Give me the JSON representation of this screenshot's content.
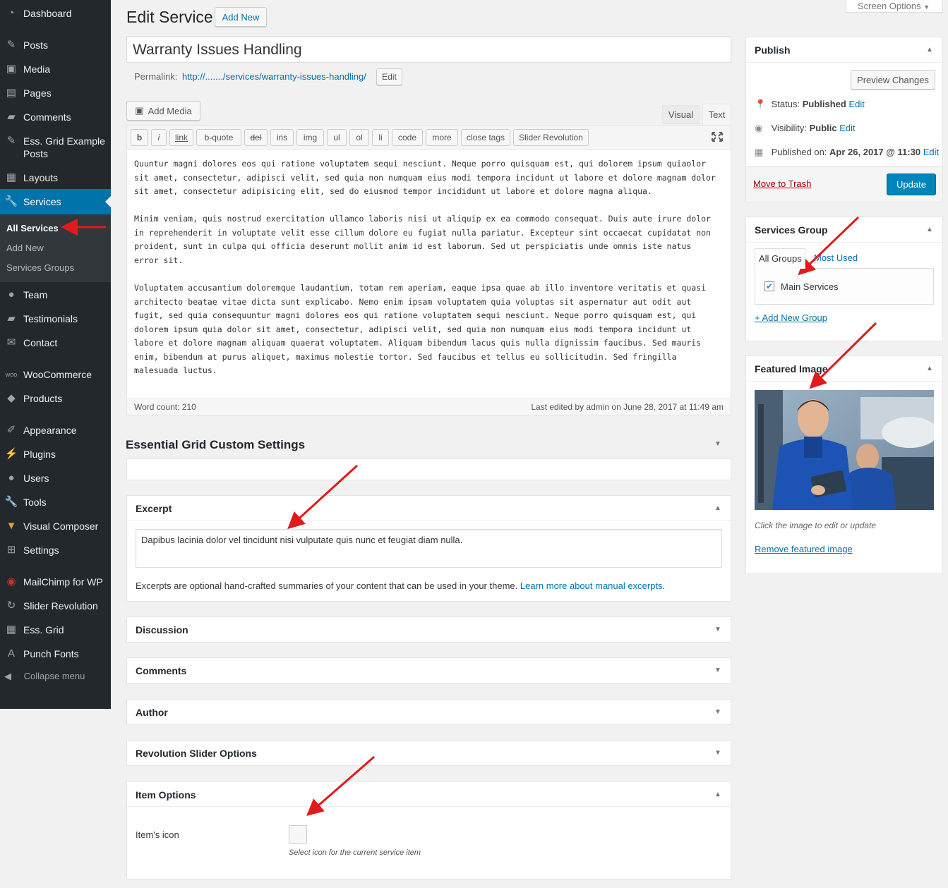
{
  "sidebar": {
    "items": [
      {
        "label": "Dashboard",
        "icon": "dashboard-icon"
      },
      {
        "label": "Posts",
        "icon": "pin-icon"
      },
      {
        "label": "Media",
        "icon": "media-icon"
      },
      {
        "label": "Pages",
        "icon": "pages-icon"
      },
      {
        "label": "Comments",
        "icon": "comment-icon"
      },
      {
        "label": "Ess. Grid Example Posts",
        "icon": "pin-icon"
      },
      {
        "label": "Layouts",
        "icon": "layouts-icon"
      },
      {
        "label": "Services",
        "icon": "wrench-icon"
      },
      {
        "label": "Team",
        "icon": "users-icon"
      },
      {
        "label": "Testimonials",
        "icon": "comment-icon"
      },
      {
        "label": "Contact",
        "icon": "mail-icon"
      },
      {
        "label": "WooCommerce",
        "icon": "woo-icon"
      },
      {
        "label": "Products",
        "icon": "box-icon"
      },
      {
        "label": "Appearance",
        "icon": "brush-icon"
      },
      {
        "label": "Plugins",
        "icon": "plugin-icon"
      },
      {
        "label": "Users",
        "icon": "user-icon"
      },
      {
        "label": "Tools",
        "icon": "tools-icon"
      },
      {
        "label": "Visual Composer",
        "icon": "vc-icon"
      },
      {
        "label": "Settings",
        "icon": "settings-icon"
      },
      {
        "label": "MailChimp for WP",
        "icon": "mailchimp-icon"
      },
      {
        "label": "Slider Revolution",
        "icon": "refresh-icon"
      },
      {
        "label": "Ess. Grid",
        "icon": "grid-icon"
      },
      {
        "label": "Punch Fonts",
        "icon": "font-icon"
      }
    ],
    "submenu": [
      "All Services",
      "Add New",
      "Services Groups"
    ],
    "collapse": "Collapse menu"
  },
  "header": {
    "title": "Edit Service",
    "add_new": "Add New",
    "screen_options": "Screen Options"
  },
  "editor": {
    "post_title": "Warranty Issues Handling",
    "permalink_label": "Permalink:",
    "permalink_url": "http://......./services/warranty-issues-handling/",
    "permalink_edit": "Edit",
    "add_media": "Add Media",
    "tab_visual": "Visual",
    "tab_text": "Text",
    "quicktags": [
      "b",
      "i",
      "link",
      "b-quote",
      "del",
      "ins",
      "img",
      "ul",
      "ol",
      "li",
      "code",
      "more",
      "close tags",
      "Slider Revolution"
    ],
    "lines": [
      "Quuntur magni dolores eos qui ratione voluptatem sequi nesciunt. Neque porro quisquam est, qui dolorem ipsum quiaolor",
      "sit amet, consectetur, adipisci velit, sed quia non numquam eius modi tempora incidunt ut labore et dolore magnam dolor",
      "sit amet, consectetur adipisicing elit, sed do eiusmod tempor incididunt ut labore et dolore magna aliqua.",
      "",
      "Minim veniam, quis nostrud exercitation ullamco laboris nisi ut aliquip ex ea commodo consequat. Duis aute irure dolor",
      "in reprehenderit in voluptate velit esse cillum dolore eu fugiat nulla pariatur. Excepteur sint occaecat cupidatat non",
      "proident, sunt in culpa qui officia deserunt mollit anim id est laborum. Sed ut perspiciatis unde omnis iste natus",
      "error sit.",
      "",
      "Voluptatem accusantium doloremque laudantium, totam rem aperiam, eaque ipsa quae ab illo inventore veritatis et quasi",
      "architecto beatae vitae dicta sunt explicabo. Nemo enim ipsam voluptatem quia voluptas sit aspernatur aut odit aut",
      "fugit, sed quia consequuntur magni dolores eos qui ratione voluptatem sequi nesciunt. Neque porro quisquam est, qui",
      "dolorem ipsum quia dolor sit amet, consectetur, adipisci velit, sed quia non numquam eius modi tempora incidunt ut",
      "labore et dolore magnam aliquam quaerat voluptatem. Aliquam bibendum lacus quis nulla dignissim faucibus. Sed mauris",
      "enim, bibendum at purus aliquet, maximus molestie tortor. Sed faucibus et tellus eu sollicitudin. Sed fringilla",
      "malesuada luctus."
    ],
    "word_count": "Word count: 210",
    "last_edited": "Last edited by admin on June 28, 2017 at 11:49 am"
  },
  "metaboxes": {
    "essential_grid": "Essential Grid Custom Settings",
    "excerpt": {
      "title": "Excerpt",
      "value": "Dapibus lacinia dolor vel tincidunt nisi vulputate quis nunc et feugiat diam nulla.",
      "help": "Excerpts are optional hand-crafted summaries of your content that can be used in your theme.",
      "help_link": "Learn more about manual excerpts",
      "help_end": "."
    },
    "discussion": "Discussion",
    "comments": "Comments",
    "author": "Author",
    "revolution": "Revolution Slider Options",
    "item_options": {
      "title": "Item Options",
      "icon_label": "Item's icon",
      "icon_help": "Select icon for the current service item"
    }
  },
  "publish": {
    "title": "Publish",
    "preview": "Preview Changes",
    "status_label": "Status:",
    "status_value": "Published",
    "visibility_label": "Visibility:",
    "visibility_value": "Public",
    "published_label": "Published on:",
    "published_value": "Apr 26, 2017 @ 11:30",
    "edit": "Edit",
    "trash": "Move to Trash",
    "update": "Update"
  },
  "services_group": {
    "title": "Services Group",
    "tab_all": "All Groups",
    "tab_used": "Most Used",
    "item": "Main Services",
    "item_checked": true,
    "add_new": "+ Add New Group"
  },
  "featured_image": {
    "title": "Featured Image",
    "caption": "Click the image to edit or update",
    "remove": "Remove featured image"
  },
  "colors": {
    "accent": "#0073aa",
    "sidebar": "#23282d",
    "arrow": "#e01b1b",
    "trash": "#a00"
  }
}
